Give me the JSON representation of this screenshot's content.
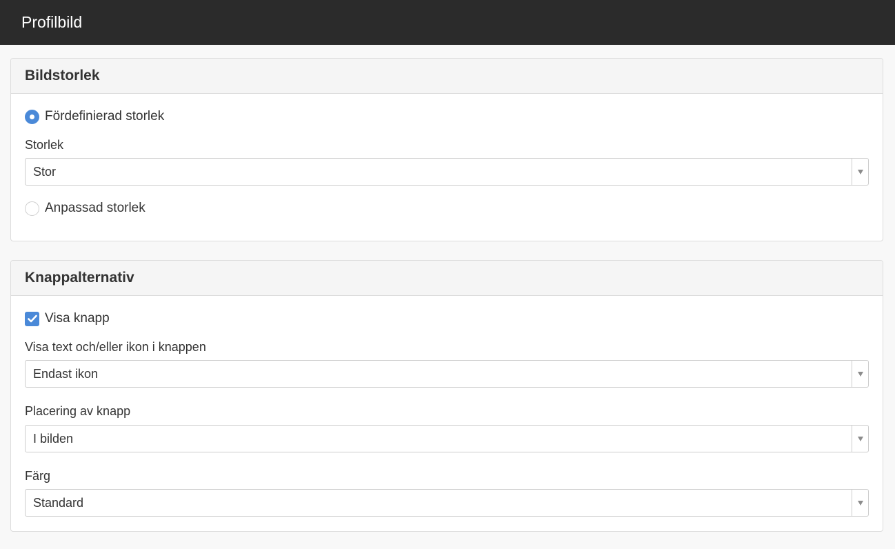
{
  "header": {
    "title": "Profilbild"
  },
  "image_size": {
    "heading": "Bildstorlek",
    "predefined_label": "Fördefinierad storlek",
    "predefined_checked": true,
    "size_label": "Storlek",
    "size_value": "Stor",
    "custom_label": "Anpassad storlek",
    "custom_checked": false
  },
  "button_options": {
    "heading": "Knappalternativ",
    "show_button_label": "Visa knapp",
    "show_button_checked": true,
    "text_icon_label": "Visa text och/eller ikon i knappen",
    "text_icon_value": "Endast ikon",
    "placement_label": "Placering av knapp",
    "placement_value": "I bilden",
    "color_label": "Färg",
    "color_value": "Standard"
  },
  "colors": {
    "accent": "#4a89d8",
    "header_bg": "#2b2b2b"
  },
  "icons": {
    "check": "check-icon",
    "dropdown": "chevron-down-icon"
  }
}
